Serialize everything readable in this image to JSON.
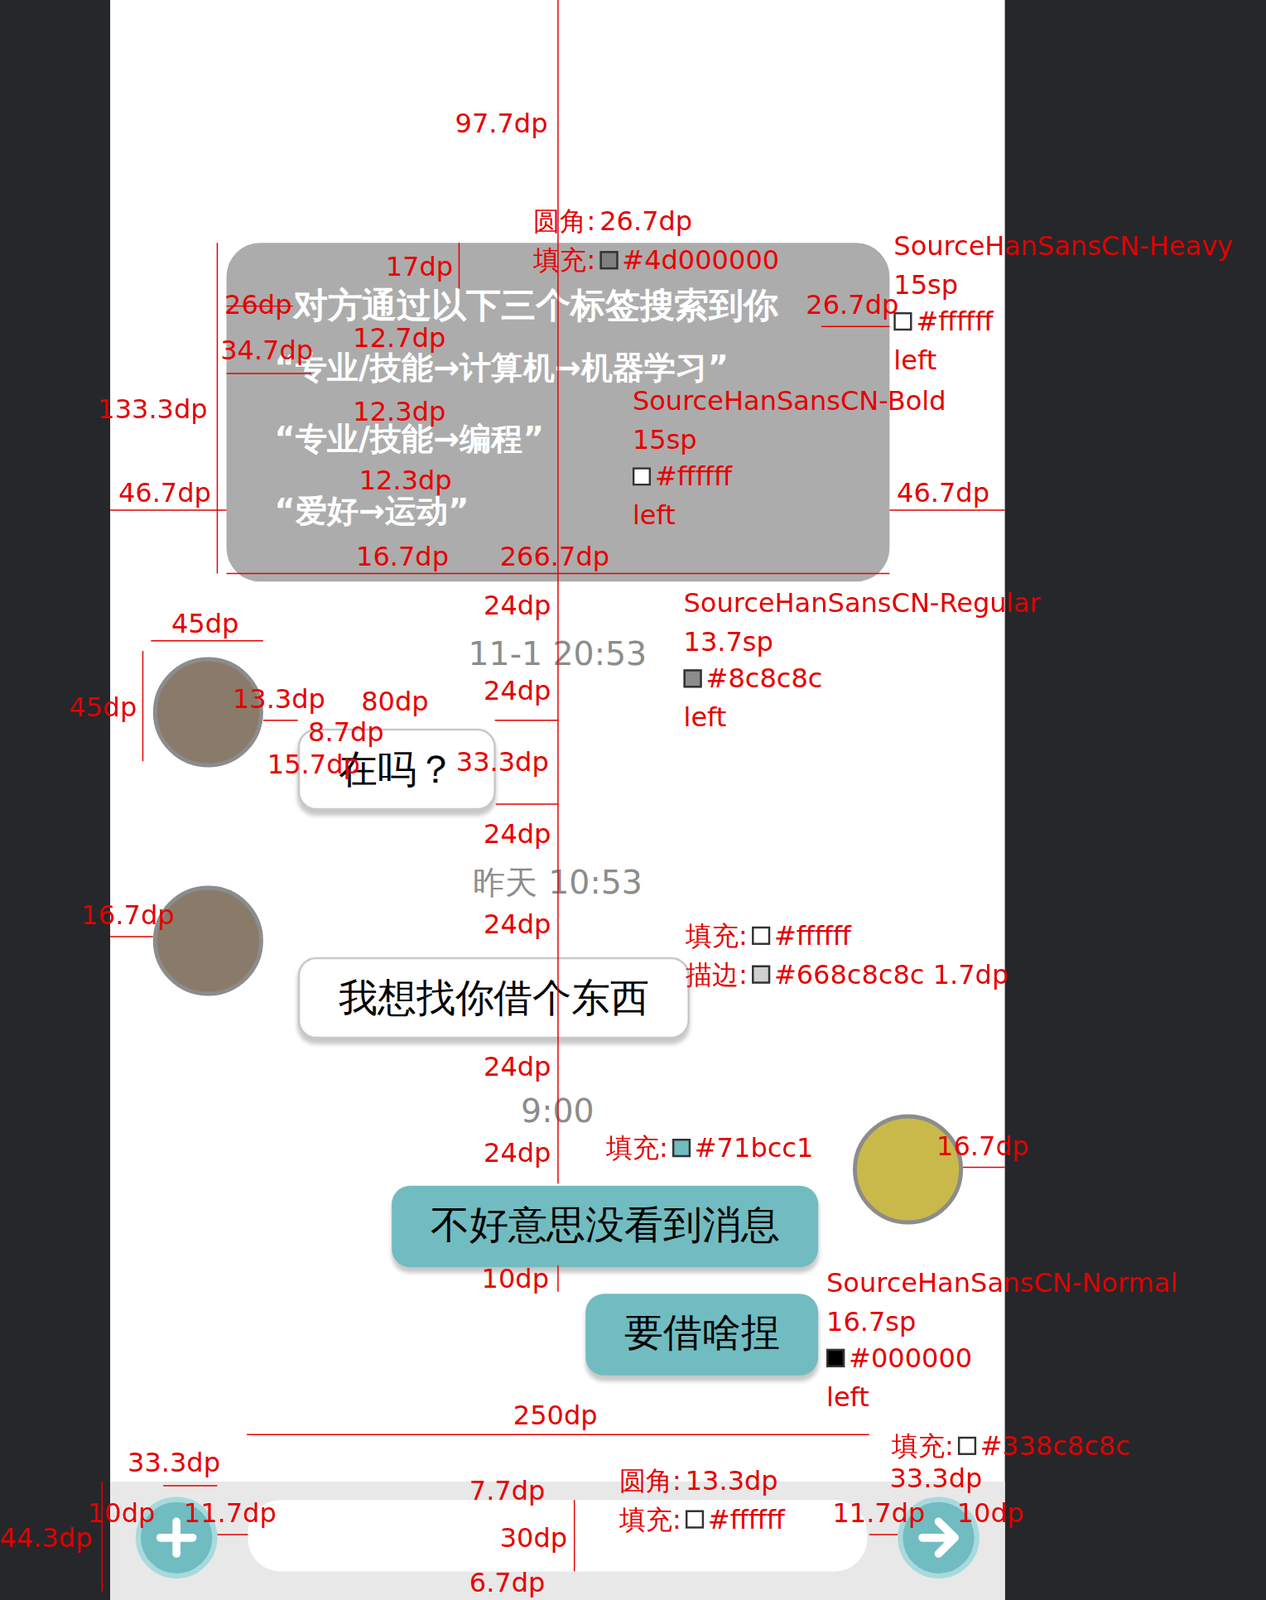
{
  "tag_card": {
    "title": "对方通过以下三个标签搜索到你",
    "tags": [
      "“专业/技能→计算机→机器学习”",
      "“专业/技能→编程”",
      "“爱好→运动”"
    ]
  },
  "message_groups": [
    {
      "time": "11-1 20:53",
      "kind": "incoming",
      "avatar_color": "#8a7a6a",
      "bubbles": [
        "在吗？"
      ]
    },
    {
      "time": "昨天 10:53",
      "kind": "incoming",
      "avatar_color": "#8a7a6a",
      "bubbles": [
        "我想找你借个东西"
      ]
    },
    {
      "time": "9:00",
      "kind": "outgoing",
      "avatar_color": "#c9b94a",
      "bubbles": [
        "不好意思没看到消息",
        "要借啥捏"
      ]
    }
  ],
  "annotations": [
    {
      "text": "97.7dp"
    },
    {
      "label": "圆角:",
      "text": "26.7dp"
    },
    {
      "label": "填充:",
      "swatch": "#808080",
      "text": "#4d000000"
    },
    {
      "text": "SourceHanSansCN-Heavy"
    },
    {
      "text": "15sp"
    },
    {
      "swatch": "#ffffff",
      "text": "#ffffff"
    },
    {
      "text": "left"
    },
    {
      "text": "17dp"
    },
    {
      "text": "26dp"
    },
    {
      "text": "26.7dp"
    },
    {
      "text": "12.7dp"
    },
    {
      "text": "34.7dp"
    },
    {
      "text": "12.3dp"
    },
    {
      "text": "SourceHanSansCN-Bold"
    },
    {
      "text": "15sp"
    },
    {
      "swatch": "#ffffff",
      "text": "#ffffff"
    },
    {
      "text": "left"
    },
    {
      "text": "133.3dp"
    },
    {
      "text": "12.3dp"
    },
    {
      "text": "46.7dp"
    },
    {
      "text": "46.7dp"
    },
    {
      "text": "16.7dp"
    },
    {
      "text": "266.7dp"
    },
    {
      "text": "24dp"
    },
    {
      "text": "SourceHanSansCN-Regular"
    },
    {
      "text": "13.7sp"
    },
    {
      "swatch": "#8c8c8c",
      "text": "#8c8c8c"
    },
    {
      "text": "left"
    },
    {
      "text": "45dp"
    },
    {
      "text": "45dp"
    },
    {
      "text": "13.3dp"
    },
    {
      "text": "80dp"
    },
    {
      "text": "24dp"
    },
    {
      "text": "8.7dp"
    },
    {
      "text": "15.7dp"
    },
    {
      "text": "33.3dp"
    },
    {
      "text": "24dp"
    },
    {
      "text": "24dp"
    },
    {
      "text": "16.7dp"
    },
    {
      "label": "填充:",
      "swatch": "#ffffff",
      "text": "#ffffff"
    },
    {
      "label": "描边:",
      "swatch": "#d0d0d0",
      "text": "#668c8c8c 1.7dp"
    },
    {
      "text": "24dp"
    },
    {
      "text": "24dp"
    },
    {
      "label": "填充:",
      "swatch": "#71bcc1",
      "text": "#71bcc1"
    },
    {
      "text": "16.7dp"
    },
    {
      "text": "10dp"
    },
    {
      "text": "SourceHanSansCN-Normal"
    },
    {
      "text": "16.7sp"
    },
    {
      "swatch": "#000000",
      "text": "#000000"
    },
    {
      "text": "left"
    },
    {
      "text": "250dp"
    },
    {
      "label": "填充:",
      "swatch": "#ffffff",
      "text": "#338c8c8c"
    },
    {
      "text": "33.3dp"
    },
    {
      "text": "33.3dp"
    },
    {
      "text": "7.7dp"
    },
    {
      "label": "圆角:",
      "text": "13.3dp"
    },
    {
      "label": "填充:",
      "swatch": "#ffffff",
      "text": "#ffffff"
    },
    {
      "text": "10dp"
    },
    {
      "text": "11.7dp"
    },
    {
      "text": "11.7dp"
    },
    {
      "text": "10dp"
    },
    {
      "text": "44.3dp"
    },
    {
      "text": "30dp"
    },
    {
      "text": "6.7dp"
    }
  ]
}
